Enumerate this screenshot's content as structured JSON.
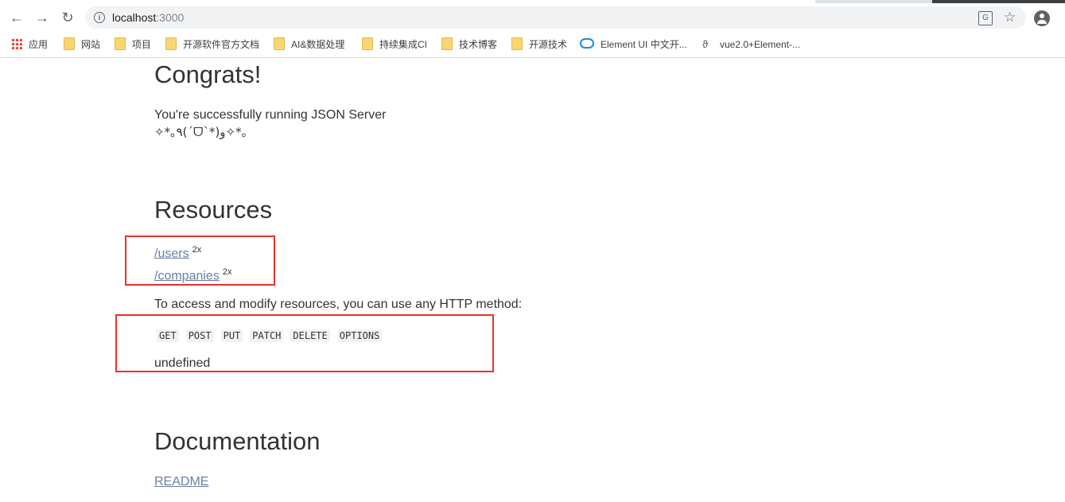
{
  "browser": {
    "url_host": "localhost",
    "url_port": ":3000",
    "icons": [
      "back-icon",
      "forward-icon",
      "reload-icon",
      "info-icon",
      "translate-icon",
      "star-icon",
      "account-icon"
    ]
  },
  "bookmarks": [
    {
      "label": "应用",
      "icon": "apps-grid-icon"
    },
    {
      "label": "网站",
      "icon": "folder-icon"
    },
    {
      "label": "项目",
      "icon": "folder-icon"
    },
    {
      "label": "开源软件官方文档",
      "icon": "folder-icon"
    },
    {
      "label": "AI&数据处理",
      "icon": "folder-icon"
    },
    {
      "label": "持续集成CI",
      "icon": "folder-icon"
    },
    {
      "label": "技术博客",
      "icon": "folder-icon"
    },
    {
      "label": "开源技术",
      "icon": "folder-icon"
    },
    {
      "label": "Element UI 中文开...",
      "icon": "cloud-icon"
    },
    {
      "label": "vue2.0+Element-...",
      "icon": "vue-icon"
    }
  ],
  "page": {
    "congrats_title": "Congrats!",
    "running_text": "You're successfully running JSON Server",
    "kaomoji": "✧*｡٩(ˊᗜˋ*)و✧*｡",
    "resources_title": "Resources",
    "resources": [
      {
        "path": "/users",
        "count": "2x"
      },
      {
        "path": "/companies",
        "count": "2x"
      }
    ],
    "access_text": "To access and modify resources, you can use any HTTP method:",
    "methods": [
      "GET",
      "POST",
      "PUT",
      "PATCH",
      "DELETE",
      "OPTIONS"
    ],
    "undefined_text": "undefined",
    "documentation_title": "Documentation",
    "readme_link": "README"
  },
  "colors": {
    "annotation_box": "#e8322b",
    "link": "#6a7fa6"
  }
}
